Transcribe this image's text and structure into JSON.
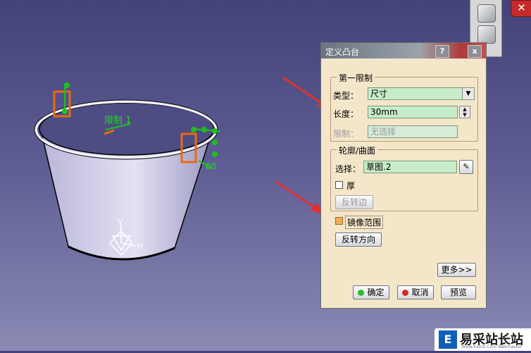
{
  "viewport": {
    "model_labels": {
      "limit_label": "限制 1",
      "dim_80": "80"
    },
    "axis": {
      "y": "V",
      "h": "H"
    }
  },
  "colors": {
    "dialog_bg": "#f4e6c9",
    "field_bg": "#c7ecc9",
    "sketch_orange": "#e86a10",
    "constraint_green": "#1fbf1f",
    "arrow_red": "#e03030"
  },
  "dialog": {
    "title": "定义凸台",
    "help_btn": "?",
    "close_btn": "x",
    "first_limit": {
      "group_title": "第一限制",
      "type_label": "类型：",
      "type_value": "尺寸",
      "length_label": "长度：",
      "length_value": "30mm",
      "limit_label": "限制：",
      "limit_value": "无选择"
    },
    "profile": {
      "group_title": "轮廓/曲面",
      "select_label": "选择：",
      "select_value": "草图.2",
      "thick_label": "厚",
      "thick_checked": false,
      "reverse_side_button": "反转边"
    },
    "mirror_label": "镜像范围",
    "mirror_checked": true,
    "reverse_dir_button": "反转方向",
    "more_button": "更多>>",
    "ok_button": "确定",
    "cancel_button": "取消",
    "preview_button": "预览"
  },
  "watermark": {
    "logo_char": "E",
    "text": "易采站长站",
    "sub": "Www.Easck.Com Webmaster"
  }
}
